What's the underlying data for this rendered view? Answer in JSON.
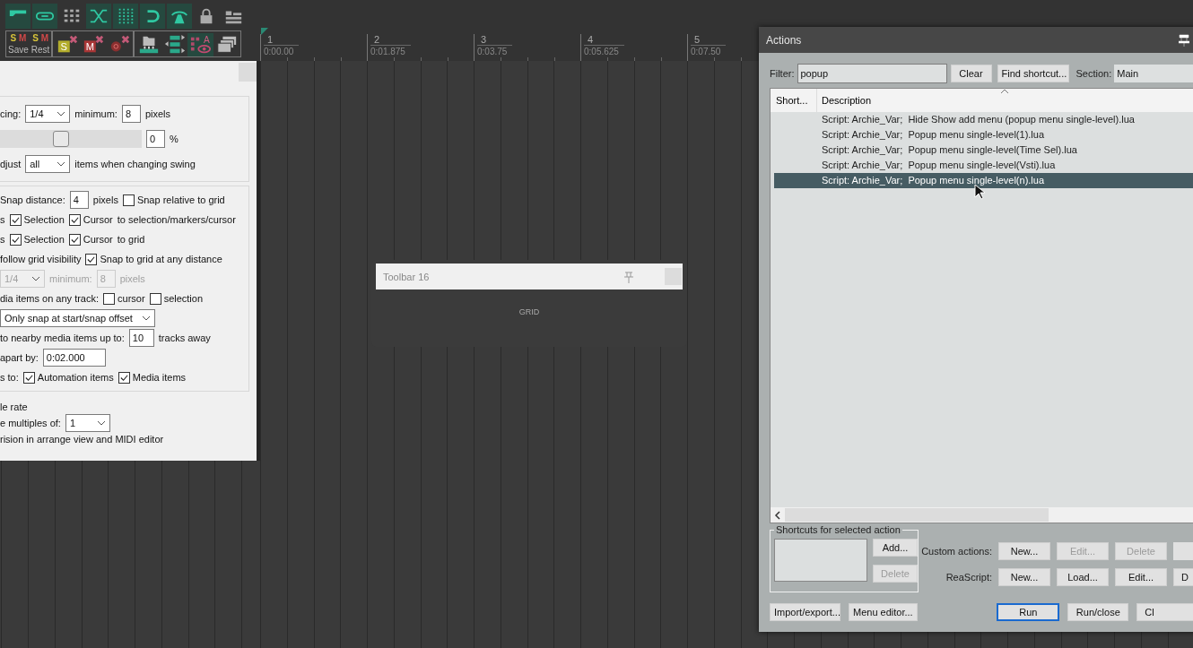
{
  "toolbar_row1": [
    {
      "on": true
    },
    {
      "on": true
    },
    {
      "on": false
    },
    {
      "on": true
    },
    {
      "on": true
    },
    {
      "on": true
    },
    {
      "on": true
    },
    {
      "on": false
    },
    {
      "on": false
    }
  ],
  "snapshots": [
    {
      "s": "S",
      "m": "M",
      "label": "Save"
    },
    {
      "s": "S",
      "m": "M",
      "label": "Rest"
    }
  ],
  "toolbar_row2": [
    {
      "letter": "S",
      "on": false
    },
    {
      "letter": "M",
      "on": false
    },
    {
      "on": false
    },
    {
      "on": false
    },
    {
      "on": false
    },
    {
      "letter": "A",
      "on": true
    },
    {
      "on": false
    }
  ],
  "ruler": [
    {
      "bar": "1",
      "time": "0:00.00"
    },
    {
      "bar": "2",
      "time": "0:01.875"
    },
    {
      "bar": "3",
      "time": "0:03.75"
    },
    {
      "bar": "4",
      "time": "0:05.625"
    },
    {
      "bar": "5",
      "time": "0:07.50"
    }
  ],
  "grid_settings": {
    "groups": [
      {
        "rows": [
          {
            "disabled": false,
            "parts": [
              {
                "kind": "text",
                "text": "cing:"
              },
              {
                "kind": "combo",
                "value": "1/4"
              },
              {
                "kind": "text",
                "text": "minimum:"
              },
              {
                "kind": "field",
                "value": "8"
              },
              {
                "kind": "text",
                "text": "pixels"
              }
            ]
          },
          {
            "disabled": false,
            "parts": [
              {
                "kind": "slider",
                "level": 0.42
              },
              {
                "kind": "field",
                "value": "0"
              },
              {
                "kind": "text",
                "text": "%"
              }
            ]
          },
          {
            "disabled": false,
            "parts": [
              {
                "kind": "text",
                "text": "djust"
              },
              {
                "kind": "combo",
                "value": "all"
              },
              {
                "kind": "text",
                "text": "items when changing swing"
              }
            ]
          }
        ]
      },
      {
        "rows": [
          {
            "disabled": false,
            "parts": [
              {
                "kind": "text",
                "text": "Snap distance:"
              },
              {
                "kind": "field",
                "value": "4"
              },
              {
                "kind": "text",
                "text": "pixels"
              },
              {
                "kind": "checkbox",
                "text": "Snap relative to grid",
                "checked": false
              }
            ]
          },
          {
            "disabled": false,
            "parts": [
              {
                "kind": "text",
                "text": "s"
              },
              {
                "kind": "checkbox",
                "text": "Selection",
                "checked": true
              },
              {
                "kind": "checkbox",
                "text": "Cursor",
                "checked": true
              },
              {
                "kind": "text",
                "text": "to selection/markers/cursor"
              }
            ]
          },
          {
            "disabled": false,
            "parts": [
              {
                "kind": "text",
                "text": "s"
              },
              {
                "kind": "checkbox",
                "text": "Selection",
                "checked": true
              },
              {
                "kind": "checkbox",
                "text": "Cursor",
                "checked": true
              },
              {
                "kind": "text",
                "text": "to grid"
              }
            ]
          },
          {
            "disabled": false,
            "parts": [
              {
                "kind": "text",
                "text": "follow grid visibility"
              },
              {
                "kind": "checkbox",
                "text": "Snap to grid at any distance",
                "checked": true
              }
            ]
          },
          {
            "disabled": true,
            "parts": [
              {
                "kind": "combo",
                "value": "1/4"
              },
              {
                "kind": "text",
                "text": "minimum:"
              },
              {
                "kind": "field",
                "value": "8"
              },
              {
                "kind": "text",
                "text": "pixels"
              }
            ]
          },
          {
            "disabled": false,
            "parts": [
              {
                "kind": "text",
                "text": "dia items on any track:"
              },
              {
                "kind": "checkbox",
                "text": "cursor",
                "checked": false
              },
              {
                "kind": "checkbox",
                "text": "selection",
                "checked": false
              }
            ]
          },
          {
            "disabled": false,
            "parts": [
              {
                "kind": "combo",
                "value": "Only snap at start/snap offset"
              }
            ]
          },
          {
            "disabled": false,
            "parts": [
              {
                "kind": "text",
                "text": "to nearby media items up to:"
              },
              {
                "kind": "field",
                "value": "10"
              },
              {
                "kind": "text",
                "text": "tracks away"
              }
            ]
          },
          {
            "disabled": false,
            "parts": [
              {
                "kind": "text",
                "text": "apart by:"
              },
              {
                "kind": "field",
                "value": "0:02.000"
              }
            ]
          },
          {
            "disabled": false,
            "parts": [
              {
                "kind": "text",
                "text": "s to:"
              },
              {
                "kind": "checkbox",
                "text": "Automation items",
                "checked": true
              },
              {
                "kind": "checkbox",
                "text": "Media items",
                "checked": true
              }
            ]
          }
        ]
      }
    ],
    "rows": [
      {
        "disabled": false,
        "parts": [
          {
            "kind": "text",
            "text": "le rate"
          }
        ]
      },
      {
        "disabled": false,
        "parts": [
          {
            "kind": "text",
            "text": "e multiples of:"
          },
          {
            "kind": "combo",
            "value": "1"
          }
        ]
      },
      {
        "disabled": false,
        "parts": [
          {
            "kind": "text",
            "text": "rision in arrange view and MIDI editor"
          }
        ]
      }
    ]
  },
  "toolbar_window": {
    "title": "Toolbar 16",
    "button": "GRID"
  },
  "actions": {
    "title": "Actions",
    "filter": {
      "label": "Filter:",
      "value": "popup"
    },
    "top_buttons": [
      "Clear",
      "Find shortcut..."
    ],
    "section": {
      "label": "Section:",
      "value": "Main"
    },
    "columns": [
      "Short...",
      "Description"
    ],
    "rows": [
      {
        "description": "Script: Archie_Var;  Hide Show add menu (popup menu single-level).lua",
        "selected": false
      },
      {
        "description": "Script: Archie_Var;  Popup menu single-level(1).lua",
        "selected": false
      },
      {
        "description": "Script: Archie_Var;  Popup menu single-level(Time Sel).lua",
        "selected": false
      },
      {
        "description": "Script: Archie_Var;  Popup menu single-level(Vsti).lua",
        "selected": false
      },
      {
        "description": "Script: Archie_Var;  Popup menu single-level(n).lua",
        "selected": true
      }
    ],
    "shortcuts": {
      "title": "Shortcuts for selected action",
      "buttons": [
        {
          "label": "Add...",
          "disabled": false
        },
        {
          "label": "Delete",
          "disabled": true
        }
      ]
    },
    "button_rows": [
      {
        "label": "Custom actions:",
        "buttons": [
          {
            "label": "New...",
            "disabled": false
          },
          {
            "label": "Edit...",
            "disabled": true
          },
          {
            "label": "Delete",
            "disabled": true
          }
        ]
      },
      {
        "label": "ReaScript:",
        "buttons": [
          {
            "label": "New...",
            "disabled": false
          },
          {
            "label": "Load...",
            "disabled": false
          },
          {
            "label": "Edit...",
            "disabled": false
          },
          {
            "label": "D",
            "disabled": false
          }
        ]
      }
    ],
    "left_buttons": [
      "Import/export...",
      "Menu editor..."
    ],
    "right_buttons": [
      {
        "label": "Run",
        "focused": true
      },
      {
        "label": "Run/close",
        "focused": false
      },
      {
        "label": "Cl",
        "focused": false
      }
    ]
  }
}
